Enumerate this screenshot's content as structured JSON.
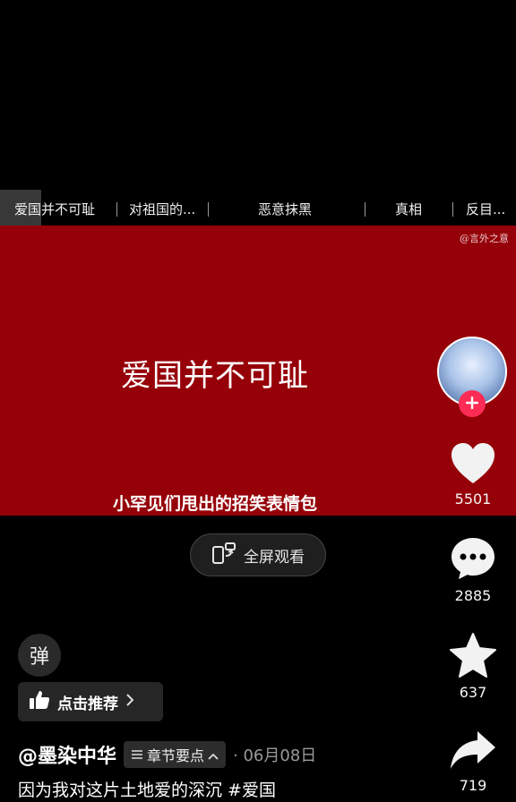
{
  "chapters": [
    {
      "label": "爱国并不可耻",
      "active": true
    },
    {
      "label": "对祖国的...",
      "active": false
    },
    {
      "label": "恶意抹黑",
      "active": false
    },
    {
      "label": "真相",
      "active": false
    },
    {
      "label": "反目...",
      "active": false
    }
  ],
  "video": {
    "watermark": "@言外之意",
    "title": "爱国并不可耻",
    "subtitle": "小罕见们甩出的招笑表情包",
    "background": "#960008"
  },
  "fullscreen": {
    "label": "全屏观看",
    "icon": "rotate-phone-icon"
  },
  "rail": {
    "likes": "5501",
    "comments": "2885",
    "favorites": "637",
    "shares": "719",
    "follow_color": "#fe2c55"
  },
  "danmu": {
    "label": "弹"
  },
  "recommend": {
    "label": "点击推荐",
    "icon": "thumbs-up-icon"
  },
  "post": {
    "author": "@墨染中华",
    "chapters_tag": "章节要点",
    "date": "· 06月08日",
    "caption": "因为我对这片土地爱的深沉 #爱国"
  }
}
